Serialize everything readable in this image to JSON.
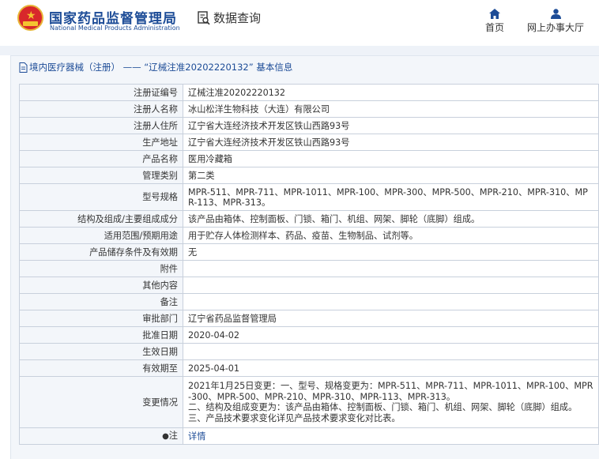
{
  "header": {
    "org_cn": "国家药品监督管理局",
    "org_en": "National Medical Products Administration",
    "query_label": "数据查询",
    "nav_home": "首页",
    "nav_office": "网上办事大厅",
    "brand_color": "#1d4c97"
  },
  "breadcrumb": "境内医疗器械（注册） —— “辽械注准20202220132” 基本信息",
  "rows": [
    {
      "label": "注册证编号",
      "value": "辽械注准20202220132"
    },
    {
      "label": "注册人名称",
      "value": "冰山松洋生物科技（大连）有限公司"
    },
    {
      "label": "注册人住所",
      "value": "辽宁省大连经济技术开发区铁山西路93号"
    },
    {
      "label": "生产地址",
      "value": "辽宁省大连经济技术开发区铁山西路93号"
    },
    {
      "label": "产品名称",
      "value": "医用冷藏箱"
    },
    {
      "label": "管理类别",
      "value": "第二类"
    },
    {
      "label": "型号规格",
      "value": "MPR-511、MPR-711、MPR-1011、MPR-100、MPR-300、MPR-500、MPR-210、MPR-310、MPR-113、MPR-313。"
    },
    {
      "label": "结构及组成/主要组成成分",
      "value": "该产品由箱体、控制面板、门锁、箱门、机组、网架、脚轮（底脚）组成。"
    },
    {
      "label": "适用范围/预期用途",
      "value": "用于贮存人体检测样本、药品、疫苗、生物制品、试剂等。"
    },
    {
      "label": "产品储存条件及有效期",
      "value": "无"
    },
    {
      "label": "附件",
      "value": ""
    },
    {
      "label": "其他内容",
      "value": ""
    },
    {
      "label": "备注",
      "value": ""
    },
    {
      "label": "审批部门",
      "value": "辽宁省药品监督管理局"
    },
    {
      "label": "批准日期",
      "value": "2020-04-02"
    },
    {
      "label": "生效日期",
      "value": ""
    },
    {
      "label": "有效期至",
      "value": "2025-04-01"
    },
    {
      "label": "变更情况",
      "value": "2021年1月25日变更：一、型号、规格变更为：MPR-511、MPR-711、MPR-1011、MPR-100、MPR-300、MPR-500、MPR-210、MPR-310、MPR-113、MPR-313。\n二、结构及组成变更为：该产品由箱体、控制面板、门锁、箱门、机组、网架、脚轮（底脚）组成。\n三、产品技术要求变化详见产品技术要求变化对比表。"
    }
  ],
  "note_label": "注",
  "note_link": "详情"
}
